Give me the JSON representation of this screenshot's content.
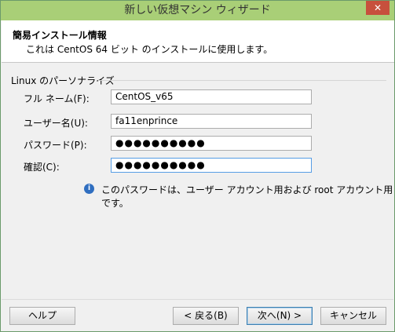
{
  "window": {
    "title": "新しい仮想マシン ウィザード",
    "close_label": "✕"
  },
  "header": {
    "title": "簡易インストール情報",
    "subtitle": "これは CentOS 64 ビット のインストールに使用します。"
  },
  "form": {
    "group_label": "Linux のパーソナライズ",
    "fullname": {
      "label": "フル ネーム(F):",
      "value": "CentOS_v65"
    },
    "username": {
      "label": "ユーザー名(U):",
      "value": "fa11enprince"
    },
    "password": {
      "label": "パスワード(P):",
      "value": "●●●●●●●●●●"
    },
    "confirm": {
      "label": "確認(C):",
      "value": "●●●●●●●●●●"
    }
  },
  "info": {
    "icon": "info-icon",
    "text": "このパスワードは、ユーザー アカウント用および root アカウント用です。"
  },
  "buttons": {
    "help": "ヘルプ",
    "back": "< 戻る(B)",
    "next": "次へ(N) >",
    "cancel": "キャンセル"
  }
}
